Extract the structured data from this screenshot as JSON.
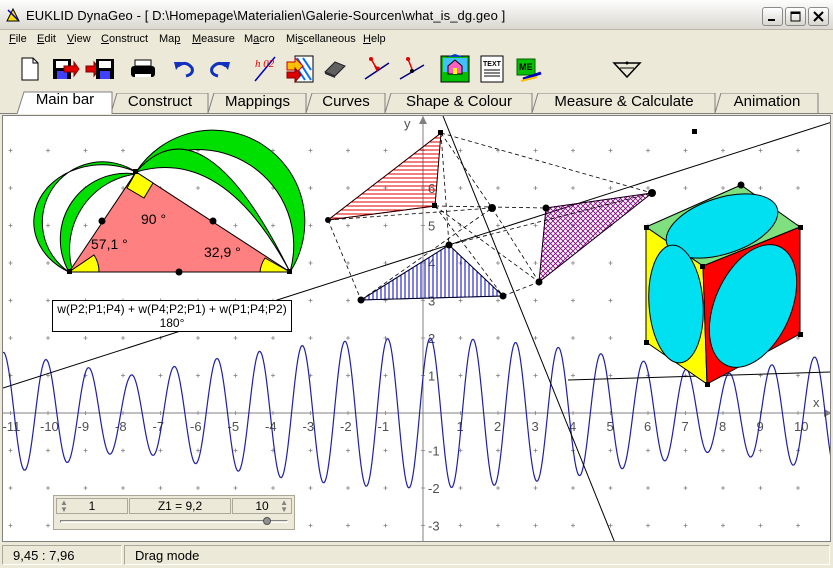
{
  "window": {
    "title": "EUKLID DynaGeo - [ D:\\Homepage\\Materialien\\Galerie-Sourcen\\what_is_dg.geo ]",
    "icons": {
      "app": "dynageo-app-icon",
      "minimize": "minimize-icon",
      "maximize": "maximize-icon",
      "close": "close-icon"
    }
  },
  "menu": [
    {
      "label": "File",
      "accel": "F"
    },
    {
      "label": "Edit",
      "accel": "E"
    },
    {
      "label": "View",
      "accel": "V"
    },
    {
      "label": "Construct",
      "accel": "C"
    },
    {
      "label": "Map",
      "accel": "p"
    },
    {
      "label": "Measure",
      "accel": "M"
    },
    {
      "label": "Macro",
      "accel": "a"
    },
    {
      "label": "Miscellaneous",
      "accel": "s"
    },
    {
      "label": "Help",
      "accel": "H"
    }
  ],
  "toolbar": [
    {
      "name": "new-file-icon"
    },
    {
      "name": "open-file-icon"
    },
    {
      "name": "save-file-icon"
    },
    {
      "name": "print-icon"
    },
    {
      "name": "undo-icon"
    },
    {
      "name": "redo-icon"
    },
    {
      "name": "show-hide-icon"
    },
    {
      "name": "style-colour-icon"
    },
    {
      "name": "eraser-icon"
    },
    {
      "name": "trace-point-icon"
    },
    {
      "name": "animate-point-icon"
    },
    {
      "name": "image-icon"
    },
    {
      "name": "text-icon"
    },
    {
      "name": "macro-icon"
    },
    {
      "name": "drag-mode-icon"
    }
  ],
  "toolbar_labels": {
    "text_icon": "TEXT",
    "h02": "h 02"
  },
  "tabs": [
    {
      "label": "Main bar",
      "active": true
    },
    {
      "label": "Construct",
      "active": false
    },
    {
      "label": "Mappings",
      "active": false
    },
    {
      "label": "Curves",
      "active": false
    },
    {
      "label": "Shape & Colour",
      "active": false
    },
    {
      "label": "Measure & Calculate",
      "active": false
    },
    {
      "label": "Animation",
      "active": false
    }
  ],
  "canvas": {
    "axes": {
      "x_label": "x",
      "y_label": "y",
      "x_ticks": [
        "-11",
        "-10",
        "-9",
        "-8",
        "-7",
        "-6",
        "-5",
        "-4",
        "-3",
        "-2",
        "-1",
        "0",
        "1",
        "2",
        "3",
        "4",
        "5",
        "6",
        "7",
        "8",
        "9",
        "10"
      ],
      "y_ticks": [
        "6",
        "5",
        "4",
        "3",
        "2",
        "1",
        "-1",
        "-2",
        "-3"
      ]
    },
    "triangle_angles": {
      "top": "90 °",
      "left": "57,1 °",
      "right": "32,9 °"
    },
    "formula": {
      "line1": "w(P2;P1;P4) + w(P4;P2;P1) + w(P1;P4;P2)",
      "line2": "180°"
    },
    "slider": {
      "min": "1",
      "value": "Z1 = 9,2",
      "max": "10",
      "position": 0.91
    },
    "colors": {
      "triangle_fill": "#ff8080",
      "lune_fill": "#00e000",
      "angle_fill": "#ffff00",
      "hatch_red": "#e00000",
      "hatch_blue": "#0000c0",
      "hatch_purple": "#800080",
      "cube_red": "#ff0000",
      "cube_yellow": "#ffff00",
      "cube_green": "#80e080",
      "ellipse_fill": "#00e0f0",
      "wave": "#2020a0"
    }
  },
  "status": {
    "coords": "9,45 : 7,96",
    "mode": "Drag mode"
  }
}
